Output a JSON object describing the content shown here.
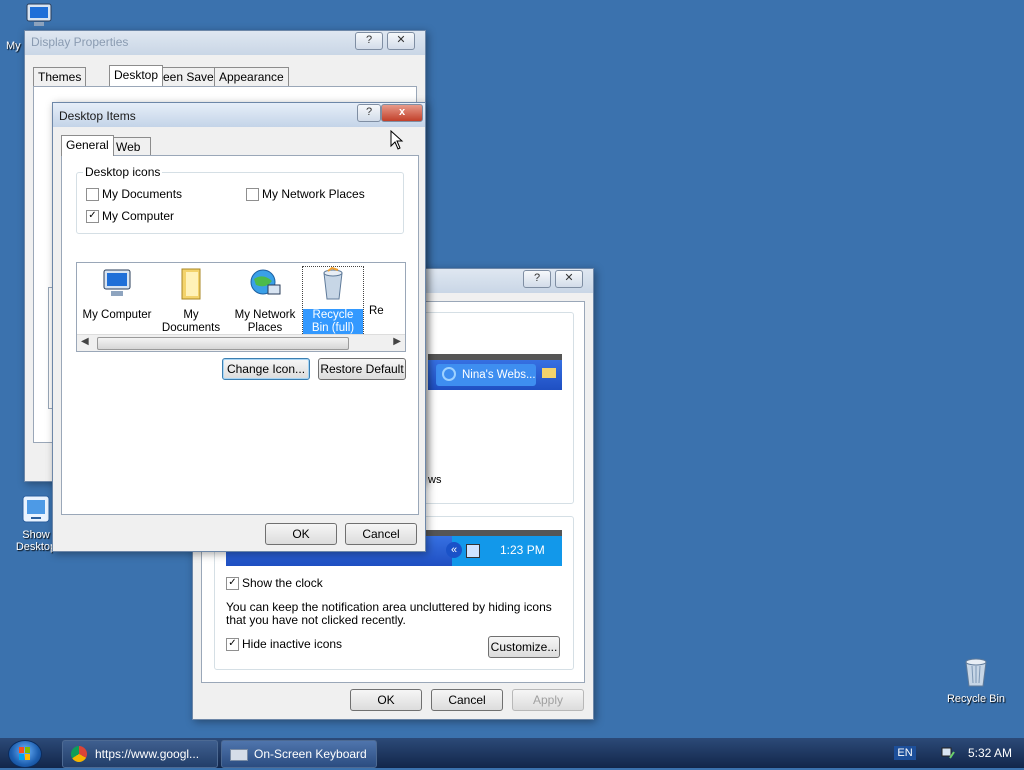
{
  "desktop": {
    "icons": [
      {
        "label": "My",
        "icon": "my-computer-icon"
      },
      {
        "label": "Show Desktop",
        "icon": "show-desktop-icon"
      },
      {
        "label": "Recycle Bin",
        "icon": "recycle-bin-icon"
      }
    ]
  },
  "display_properties": {
    "title": "Display Properties",
    "tabs": [
      "Themes",
      "Desktop",
      "Screen Saver",
      "Appearance"
    ],
    "active_tab": "Desktop"
  },
  "taskbar_properties": {
    "preview_item": "Nina's Webs...",
    "fragment_text": "ws",
    "clock_preview": "1:23 PM",
    "show_clock_label": "Show the clock",
    "show_clock_checked": true,
    "note": "You can keep the notification area uncluttered by hiding icons that you have not clicked recently.",
    "hide_inactive_label": "Hide inactive icons",
    "hide_inactive_checked": true,
    "customize_label": "Customize...",
    "ok_label": "OK",
    "cancel_label": "Cancel",
    "apply_label": "Apply"
  },
  "desktop_items": {
    "title": "Desktop Items",
    "help_label": "?",
    "close_label": "x",
    "tabs": [
      "General",
      "Web"
    ],
    "group_title": "Desktop icons",
    "checkboxes": [
      {
        "label": "My Documents",
        "checked": false
      },
      {
        "label": "My Network Places",
        "checked": false
      },
      {
        "label": "My Computer",
        "checked": true
      }
    ],
    "icon_list": [
      {
        "label": "My Computer",
        "icon": "my-computer-icon"
      },
      {
        "label": "My Documents",
        "icon": "my-documents-icon"
      },
      {
        "label": "My Network Places",
        "icon": "my-network-places-icon"
      },
      {
        "label": "Recycle Bin (full)",
        "icon": "recycle-bin-full-icon",
        "selected": true
      },
      {
        "label": "Re",
        "icon": "recycle-bin-empty-icon"
      }
    ],
    "change_icon_label": "Change Icon...",
    "restore_default_label": "Restore Default",
    "ok_label": "OK",
    "cancel_label": "Cancel"
  },
  "taskbar": {
    "items": [
      {
        "label": "https://www.googl...",
        "icon": "chrome-icon"
      },
      {
        "label": "On-Screen Keyboard",
        "icon": "keyboard-icon"
      }
    ],
    "language": "EN",
    "clock": "5:32 AM"
  },
  "colors": {
    "desktop": "#3b72ae",
    "selection": "#3399ff",
    "xp_taskbar_preview": "#245edb"
  }
}
